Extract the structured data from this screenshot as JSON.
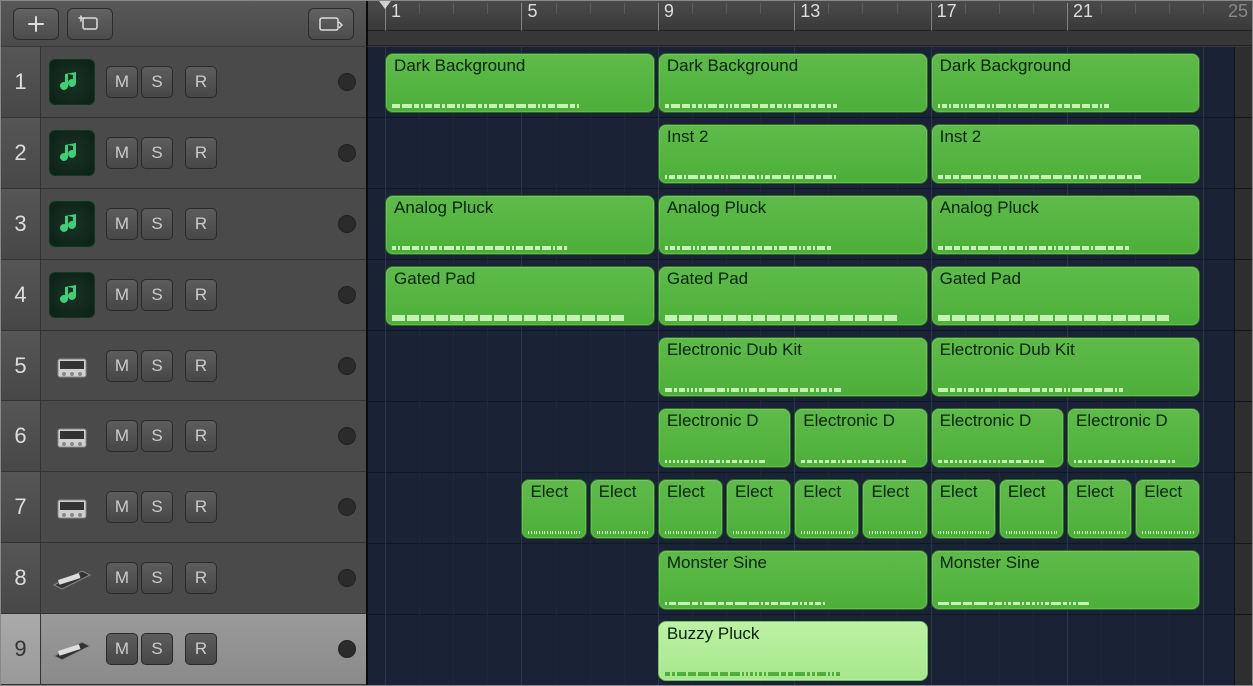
{
  "header": {
    "buttons": {
      "add": "add",
      "addTrack": "add-track-window",
      "dropdown": "dropdown"
    }
  },
  "ruler": {
    "ticks": [
      {
        "bar": 1,
        "label": "1"
      },
      {
        "bar": 5,
        "label": "5"
      },
      {
        "bar": 9,
        "label": "9"
      },
      {
        "bar": 13,
        "label": "13"
      },
      {
        "bar": 17,
        "label": "17"
      },
      {
        "bar": 21,
        "label": "21"
      }
    ],
    "endLabel": "25",
    "playheadBar": 1
  },
  "tracks": [
    {
      "num": 1,
      "icon": "soft",
      "selected": false,
      "m": "M",
      "s": "S",
      "r": "R"
    },
    {
      "num": 2,
      "icon": "soft",
      "selected": false,
      "m": "M",
      "s": "S",
      "r": "R"
    },
    {
      "num": 3,
      "icon": "soft",
      "selected": false,
      "m": "M",
      "s": "S",
      "r": "R"
    },
    {
      "num": 4,
      "icon": "soft",
      "selected": false,
      "m": "M",
      "s": "S",
      "r": "R"
    },
    {
      "num": 5,
      "icon": "drum",
      "selected": false,
      "m": "M",
      "s": "S",
      "r": "R"
    },
    {
      "num": 6,
      "icon": "drum",
      "selected": false,
      "m": "M",
      "s": "S",
      "r": "R"
    },
    {
      "num": 7,
      "icon": "drum",
      "selected": false,
      "m": "M",
      "s": "S",
      "r": "R"
    },
    {
      "num": 8,
      "icon": "keys",
      "selected": false,
      "m": "M",
      "s": "S",
      "r": "R"
    },
    {
      "num": 9,
      "icon": "keys",
      "selected": true,
      "m": "M",
      "s": "S",
      "r": "R"
    }
  ],
  "regions": [
    {
      "track": 1,
      "startBar": 1,
      "endBar": 9,
      "label": "Dark Background",
      "midi": "notes",
      "selected": false
    },
    {
      "track": 1,
      "startBar": 9,
      "endBar": 17,
      "label": "Dark Background",
      "midi": "notes",
      "selected": false
    },
    {
      "track": 1,
      "startBar": 17,
      "endBar": 25,
      "label": "Dark Background",
      "midi": "notes",
      "selected": false
    },
    {
      "track": 2,
      "startBar": 9,
      "endBar": 17,
      "label": "Inst 2",
      "midi": "notes",
      "selected": false
    },
    {
      "track": 2,
      "startBar": 17,
      "endBar": 25,
      "label": "Inst 2",
      "midi": "notes",
      "selected": false
    },
    {
      "track": 3,
      "startBar": 1,
      "endBar": 9,
      "label": "Analog Pluck",
      "midi": "notes",
      "selected": false
    },
    {
      "track": 3,
      "startBar": 9,
      "endBar": 17,
      "label": "Analog Pluck",
      "midi": "notes",
      "selected": false
    },
    {
      "track": 3,
      "startBar": 17,
      "endBar": 25,
      "label": "Analog Pluck",
      "midi": "notes",
      "selected": false
    },
    {
      "track": 4,
      "startBar": 1,
      "endBar": 9,
      "label": "Gated Pad",
      "midi": "dashed",
      "selected": false
    },
    {
      "track": 4,
      "startBar": 9,
      "endBar": 17,
      "label": "Gated Pad",
      "midi": "dashed",
      "selected": false
    },
    {
      "track": 4,
      "startBar": 17,
      "endBar": 25,
      "label": "Gated Pad",
      "midi": "dashed",
      "selected": false
    },
    {
      "track": 5,
      "startBar": 9,
      "endBar": 17,
      "label": "Electronic Dub Kit",
      "midi": "notes",
      "selected": false
    },
    {
      "track": 5,
      "startBar": 17,
      "endBar": 25,
      "label": "Electronic Dub Kit",
      "midi": "notes",
      "selected": false
    },
    {
      "track": 6,
      "startBar": 9,
      "endBar": 13,
      "label": "Electronic D",
      "midi": "dotted",
      "selected": false
    },
    {
      "track": 6,
      "startBar": 13,
      "endBar": 17,
      "label": "Electronic D",
      "midi": "dotted",
      "selected": false
    },
    {
      "track": 6,
      "startBar": 17,
      "endBar": 21,
      "label": "Electronic D",
      "midi": "dotted",
      "selected": false
    },
    {
      "track": 6,
      "startBar": 21,
      "endBar": 25,
      "label": "Electronic D",
      "midi": "dotted",
      "selected": false
    },
    {
      "track": 7,
      "startBar": 5,
      "endBar": 7,
      "label": "Elect",
      "midi": "dotted",
      "selected": false
    },
    {
      "track": 7,
      "startBar": 7,
      "endBar": 9,
      "label": "Elect",
      "midi": "dotted",
      "selected": false
    },
    {
      "track": 7,
      "startBar": 9,
      "endBar": 11,
      "label": "Elect",
      "midi": "dotted",
      "selected": false
    },
    {
      "track": 7,
      "startBar": 11,
      "endBar": 13,
      "label": "Elect",
      "midi": "dotted",
      "selected": false
    },
    {
      "track": 7,
      "startBar": 13,
      "endBar": 15,
      "label": "Elect",
      "midi": "dotted",
      "selected": false
    },
    {
      "track": 7,
      "startBar": 15,
      "endBar": 17,
      "label": "Elect",
      "midi": "dotted",
      "selected": false
    },
    {
      "track": 7,
      "startBar": 17,
      "endBar": 19,
      "label": "Elect",
      "midi": "dotted",
      "selected": false
    },
    {
      "track": 7,
      "startBar": 19,
      "endBar": 21,
      "label": "Elect",
      "midi": "dotted",
      "selected": false
    },
    {
      "track": 7,
      "startBar": 21,
      "endBar": 23,
      "label": "Elect",
      "midi": "dotted",
      "selected": false
    },
    {
      "track": 7,
      "startBar": 23,
      "endBar": 25,
      "label": "Elect",
      "midi": "dotted",
      "selected": false
    },
    {
      "track": 8,
      "startBar": 9,
      "endBar": 17,
      "label": "Monster Sine",
      "midi": "dotted",
      "selected": false
    },
    {
      "track": 8,
      "startBar": 17,
      "endBar": 25,
      "label": "Monster Sine",
      "midi": "dotted",
      "selected": false
    },
    {
      "track": 9,
      "startBar": 9,
      "endBar": 17,
      "label": "Buzzy Pluck",
      "midi": "notes",
      "selected": true
    }
  ],
  "layout": {
    "canvasWidth": 884,
    "laneHeight": 71,
    "pxPerBar": 34.1,
    "originBar": 0.5
  }
}
